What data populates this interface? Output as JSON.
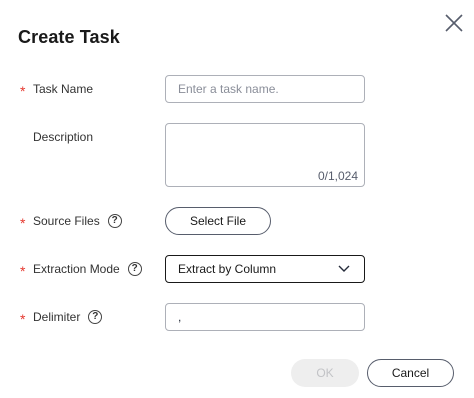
{
  "dialog": {
    "title": "Create Task",
    "close_icon": "close-icon"
  },
  "fields": {
    "task_name": {
      "label": "Task Name",
      "required": "*",
      "placeholder": "Enter a task name.",
      "value": ""
    },
    "description": {
      "label": "Description",
      "counter": "0/1,024",
      "value": ""
    },
    "source_files": {
      "label": "Source Files",
      "required": "*",
      "help_icon": "help-icon",
      "button_label": "Select File"
    },
    "extraction_mode": {
      "label": "Extraction Mode",
      "required": "*",
      "help_icon": "help-icon",
      "selected": "Extract by Column",
      "chevron_icon": "chevron-down-icon"
    },
    "delimiter": {
      "label": "Delimiter",
      "required": "*",
      "help_icon": "help-icon",
      "value": ","
    }
  },
  "footer": {
    "ok_label": "OK",
    "cancel_label": "Cancel"
  },
  "colors": {
    "required_marker": "#e5372e",
    "border": "#adb0b8",
    "disabled_bg": "#eeeeee",
    "disabled_text": "#c2c3c6"
  }
}
